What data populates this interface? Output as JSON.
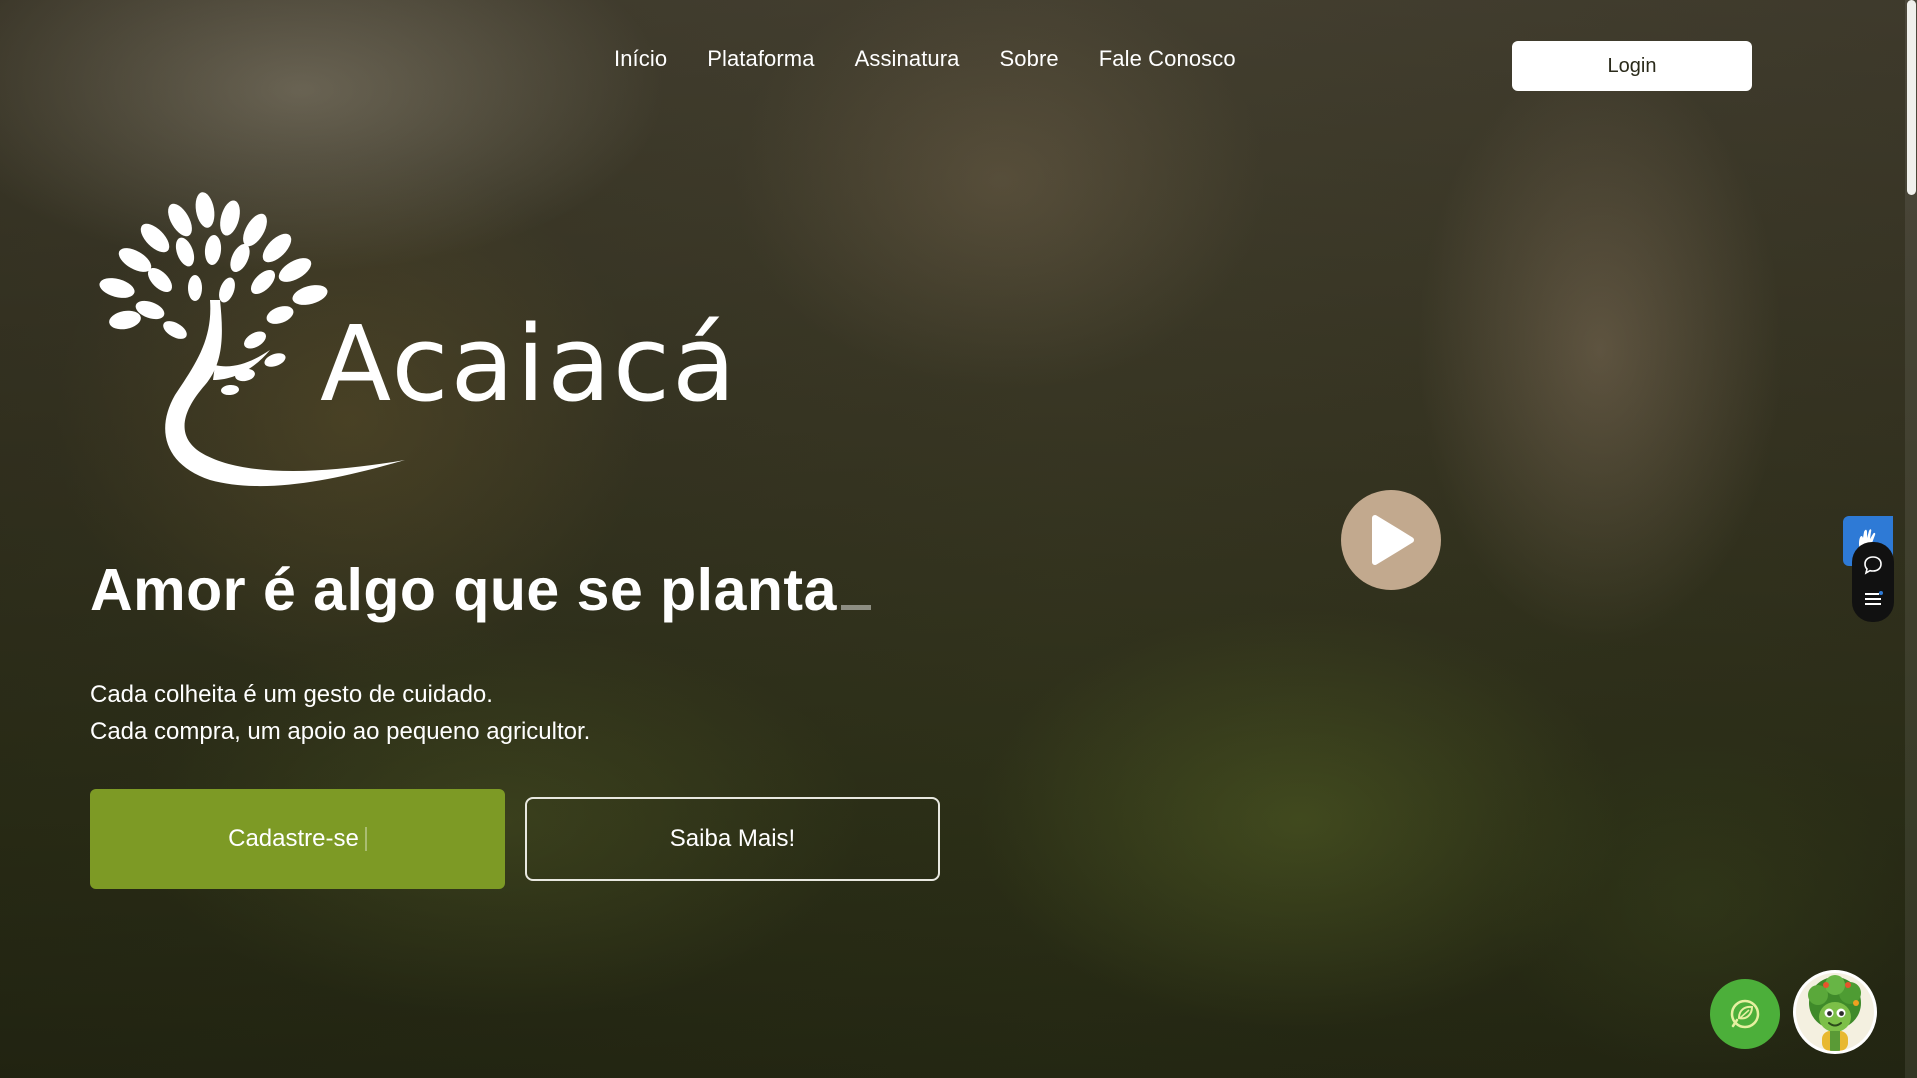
{
  "nav": {
    "items": [
      {
        "label": "Início"
      },
      {
        "label": "Plataforma"
      },
      {
        "label": "Assinatura"
      },
      {
        "label": "Sobre"
      },
      {
        "label": "Fale Conosco"
      }
    ],
    "login_label": "Login"
  },
  "brand": {
    "name": "Acaiacá"
  },
  "hero": {
    "headline": "Amor é algo que se planta",
    "tagline_line1": "Cada colheita é um gesto de cuidado.",
    "tagline_line2": "Cada compra, um apoio ao pequeno agricultor.",
    "primary_cta": "Cadastre-se",
    "secondary_cta": "Saiba Mais!"
  },
  "colors": {
    "primary_green": "#7d9a25",
    "play_button": "#c2a98e",
    "chat_green": "#4caf3a",
    "vlibras_blue": "#2e7ad6"
  },
  "icons": {
    "play": "play-icon",
    "vlibras": "hand-icon",
    "chat": "chat-bubble-icon",
    "menu": "menu-lines-icon",
    "assistant": "leaf-chat-icon",
    "mascot": "tree-mascot-avatar"
  }
}
